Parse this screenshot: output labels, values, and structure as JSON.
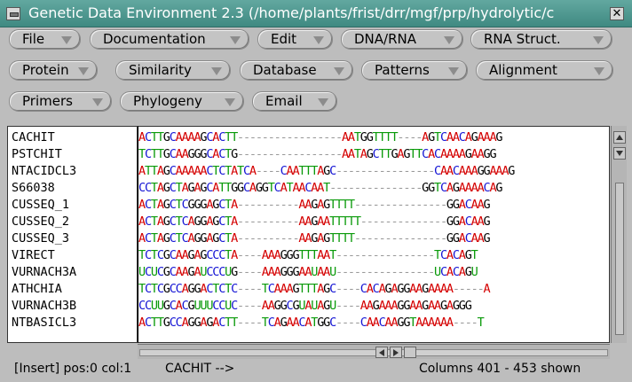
{
  "window": {
    "title": "Genetic Data Environment 2.3 (/home/plants/frist/drr/mgf/prp/hydrolytic/c",
    "close_glyph": "✕"
  },
  "menus": [
    {
      "label": "File"
    },
    {
      "label": "Documentation"
    },
    {
      "label": "Edit"
    },
    {
      "label": "DNA/RNA"
    },
    {
      "label": "RNA Struct."
    },
    {
      "label": "Protein"
    },
    {
      "label": "Similarity"
    },
    {
      "label": "Database"
    },
    {
      "label": "Patterns"
    },
    {
      "label": "Alignment"
    },
    {
      "label": "Primers"
    },
    {
      "label": "Phylogeny"
    },
    {
      "label": "Email"
    }
  ],
  "sequences": [
    {
      "name": "CACHIT",
      "seq": "ACTTGCAAAAGCACTT-----------------AATGGTTTT----AGTCAACAGAAAG"
    },
    {
      "name": "PSTCHIT",
      "seq": "TCTTGCAAGGGCACTG-----------------AATAGCTTGAGTTCACAAAAGAAGG"
    },
    {
      "name": "NTACIDCL3",
      "seq": "ATTAGCAAAAACTCTATCA----CAATTTAGC----------------CAACAAAGGAAAG"
    },
    {
      "name": "S66038",
      "seq": "CCTAGCTAGAGCATTGGCAGGTCATAACAAT---------------GGTCAGAAAACAG"
    },
    {
      "name": "CUSSEQ_1",
      "seq": "ACTAGCTCGGGAGCTA----------AAGAGTTTT---------------GGACAAG"
    },
    {
      "name": "CUSSEQ_2",
      "seq": "ACTAGCTCAGGAGCTA----------AAGAATTTTT--------------GGACAAG"
    },
    {
      "name": "CUSSEQ_3",
      "seq": "ACTAGCTCAGGAGCTA----------AAGAGTTTT---------------GGACAAG"
    },
    {
      "name": "VIRECT",
      "seq": "TCTCGCAAGAGCCCTA----AAAGGGTTTAAT----------------TCACAGT"
    },
    {
      "name": "VURNACH3A",
      "seq": "UCUCGCAAGAUCCCUG----AAAGGGAAUAAU----------------UCACAGU"
    },
    {
      "name": "ATHCHIA",
      "seq": "TCTCGCCAGGACTCTC----TCAAAGTTTAGC----CACAGAGGAAGAAAA-----A"
    },
    {
      "name": "VURNACH3B",
      "seq": "CCUUGCACGUUUCCUC----AAGGCGUAUAGU----AAGAAAGGAAGAAGAGGG"
    },
    {
      "name": "NTBASICL3",
      "seq": "ACTTGCCAGGAGACTT----TCAGAACATGGC----CAACAAGGTAAAAAA----T"
    }
  ],
  "status": {
    "mode": "[Insert] pos:0 col:1",
    "current": "CACHIT -->",
    "columns": "Columns 401 - 453 shown"
  }
}
